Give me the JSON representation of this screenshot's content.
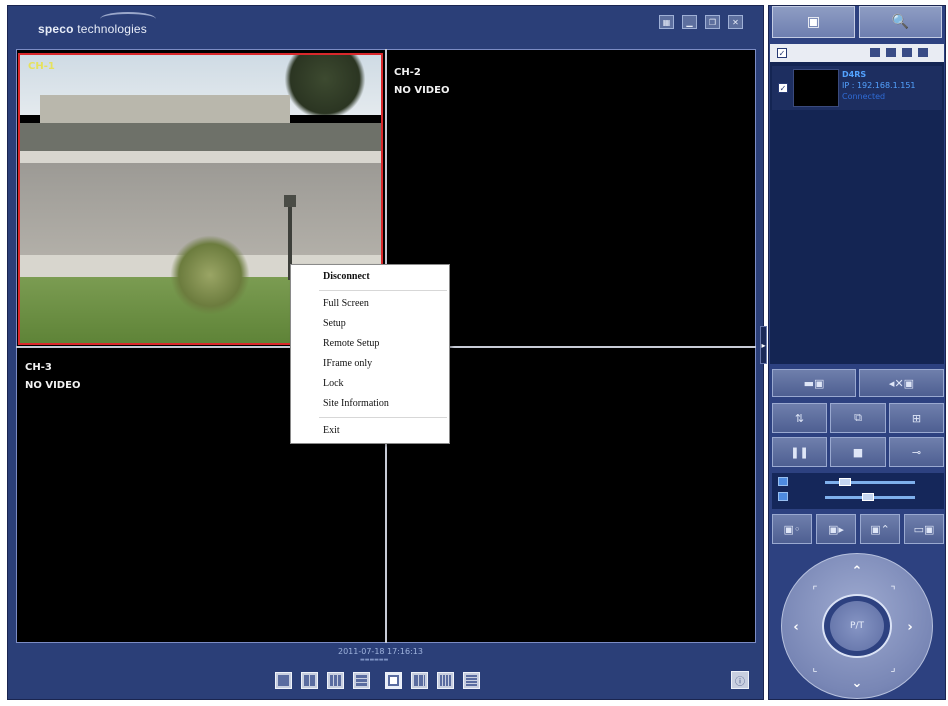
{
  "app": {
    "brand_bold": "speco",
    "brand_rest": " technologies"
  },
  "channels": [
    {
      "label": "CH-1",
      "status": ""
    },
    {
      "label": "CH-2",
      "status": "NO VIDEO"
    },
    {
      "label": "CH-3",
      "status": "NO VIDEO"
    }
  ],
  "context_menu": {
    "items": [
      "Disconnect",
      "Full Screen",
      "Setup",
      "Remote Setup",
      "IFrame only",
      "Lock",
      "Site Information",
      "Exit"
    ]
  },
  "timestamp": "2011-07-18 17:16:13",
  "site_list": {
    "name": "D4RS",
    "ip": "IP : 192.168.1.151",
    "status": "Connected"
  },
  "ptz": {
    "center_label": "P/T"
  },
  "colors": {
    "accent": "#2b3f78",
    "selected_border": "#d9282b",
    "site_text": "#53a2ff"
  },
  "sliders": {
    "brightness_level": 0.18,
    "volume_level": 0.48
  }
}
